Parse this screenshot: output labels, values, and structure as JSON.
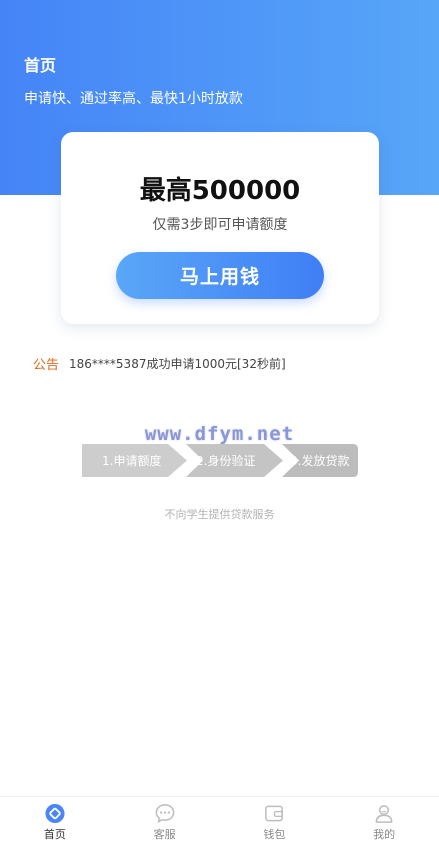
{
  "header": {
    "title": "首页",
    "subtitle": "申请快、通过率高、最快1小时放款"
  },
  "card": {
    "amount": "最高500000",
    "note": "仅需3步即可申请额度",
    "cta_label": "马上用钱"
  },
  "notice": {
    "tag": "公告",
    "text": "186****5387成功申请1000元[32秒前]"
  },
  "watermark": "www.dfym.net",
  "steps": [
    "1.申请额度",
    "2.身份验证",
    "3.发放贷款"
  ],
  "disclaimer": "不向学生提供贷款服务",
  "tabbar": {
    "items": [
      {
        "label": "首页",
        "icon": "home-diamond-icon",
        "active": true
      },
      {
        "label": "客服",
        "icon": "chat-bubble-icon",
        "active": false
      },
      {
        "label": "钱包",
        "icon": "wallet-icon",
        "active": false
      },
      {
        "label": "我的",
        "icon": "user-icon",
        "active": false
      }
    ]
  },
  "colors": {
    "primary_blue": "#4584f7",
    "accent_blue": "#57a6f8",
    "notice_orange": "#e06a1a",
    "step_gray": "#c8c8c8"
  }
}
